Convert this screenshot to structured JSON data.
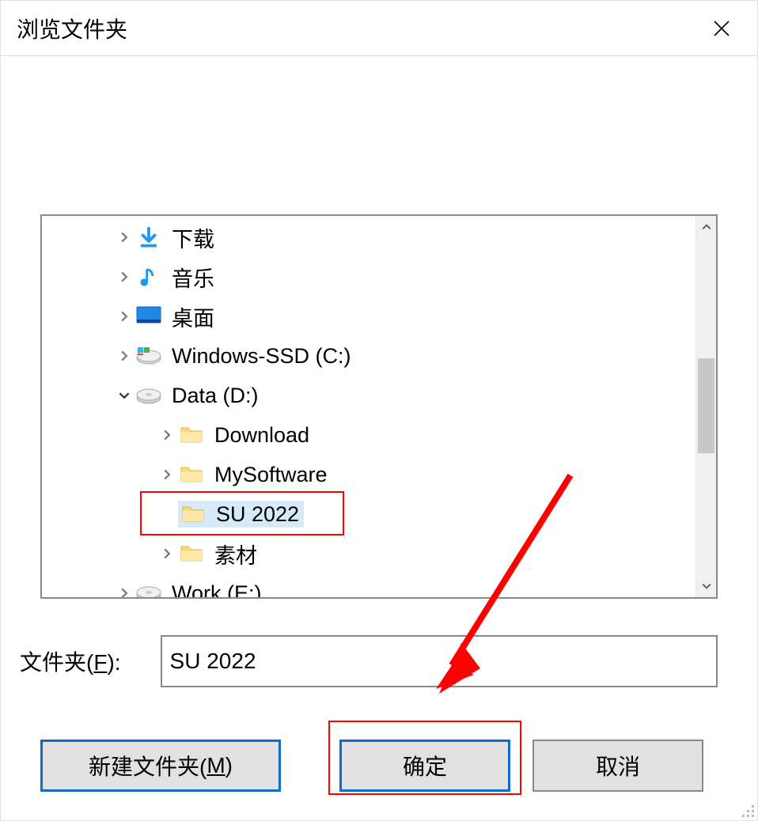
{
  "dialog": {
    "title": "浏览文件夹"
  },
  "tree": {
    "nodes": [
      {
        "indent": 1,
        "expander": "right",
        "icon": "download-icon",
        "label": "下载"
      },
      {
        "indent": 1,
        "expander": "right",
        "icon": "music-icon",
        "label": "音乐"
      },
      {
        "indent": 1,
        "expander": "right",
        "icon": "desktop-icon",
        "label": "桌面"
      },
      {
        "indent": 1,
        "expander": "right",
        "icon": "drive-os-icon",
        "label": "Windows-SSD (C:)"
      },
      {
        "indent": 1,
        "expander": "down",
        "icon": "drive-icon",
        "label": "Data (D:)"
      },
      {
        "indent": 2,
        "expander": "right",
        "icon": "folder-icon",
        "label": "Download"
      },
      {
        "indent": 2,
        "expander": "right",
        "icon": "folder-icon",
        "label": "MySoftware"
      },
      {
        "indent": 2,
        "expander": "none",
        "icon": "folder-icon",
        "label": "SU 2022",
        "selected": true,
        "highlighted": true
      },
      {
        "indent": 2,
        "expander": "right",
        "icon": "folder-icon",
        "label": "素材"
      },
      {
        "indent": 1,
        "expander": "right",
        "icon": "drive-icon",
        "label": "Work (E:)"
      }
    ]
  },
  "folderField": {
    "label_pre": "文件夹(",
    "label_hotkey": "F",
    "label_post": "):",
    "value": "SU 2022"
  },
  "buttons": {
    "newFolder_pre": "新建文件夹(",
    "newFolder_hotkey": "M",
    "newFolder_post": ")",
    "ok": "确定",
    "cancel": "取消"
  },
  "annotations": {
    "highlight_selected": true,
    "highlight_ok_button": true,
    "red_arrow": true
  }
}
